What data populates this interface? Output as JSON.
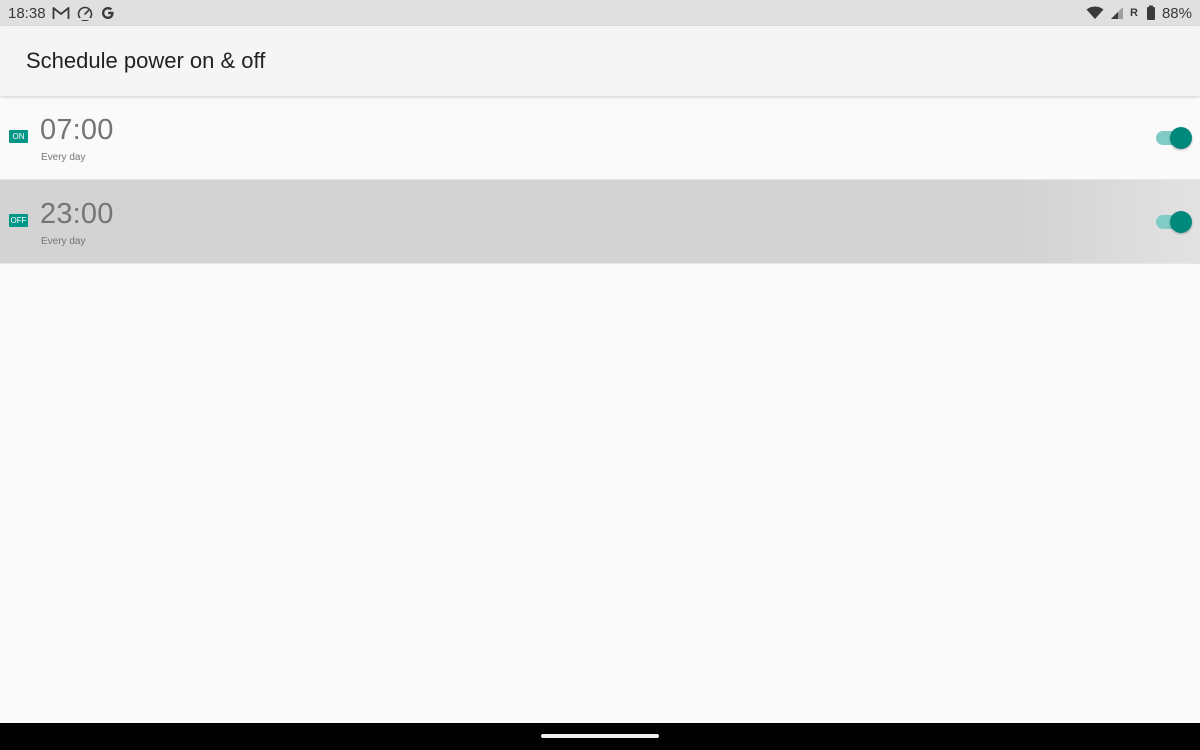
{
  "status_bar": {
    "time": "18:38",
    "left_icons": [
      "gmail-icon",
      "speedometer-icon",
      "google-g-icon"
    ],
    "right_icons": [
      "wifi-icon",
      "cell-signal-icon",
      "roaming-r-icon",
      "battery-icon"
    ],
    "roaming_label": "R",
    "battery_percent": "88%"
  },
  "app_bar": {
    "title": "Schedule power on & off"
  },
  "schedules": [
    {
      "type_label": "ON",
      "time": "07:00",
      "repeat": "Every day",
      "enabled": true
    },
    {
      "type_label": "OFF",
      "time": "23:00",
      "repeat": "Every day",
      "enabled": true
    }
  ],
  "colors": {
    "accent": "#009688",
    "toggle_thumb": "#00897b",
    "toggle_track": "#80cbc4",
    "pressed_row": "#d3d3d3",
    "status_bar_bg": "#e0e0e0",
    "app_bar_bg": "#f5f5f5",
    "nav_bar_bg": "#000000"
  }
}
